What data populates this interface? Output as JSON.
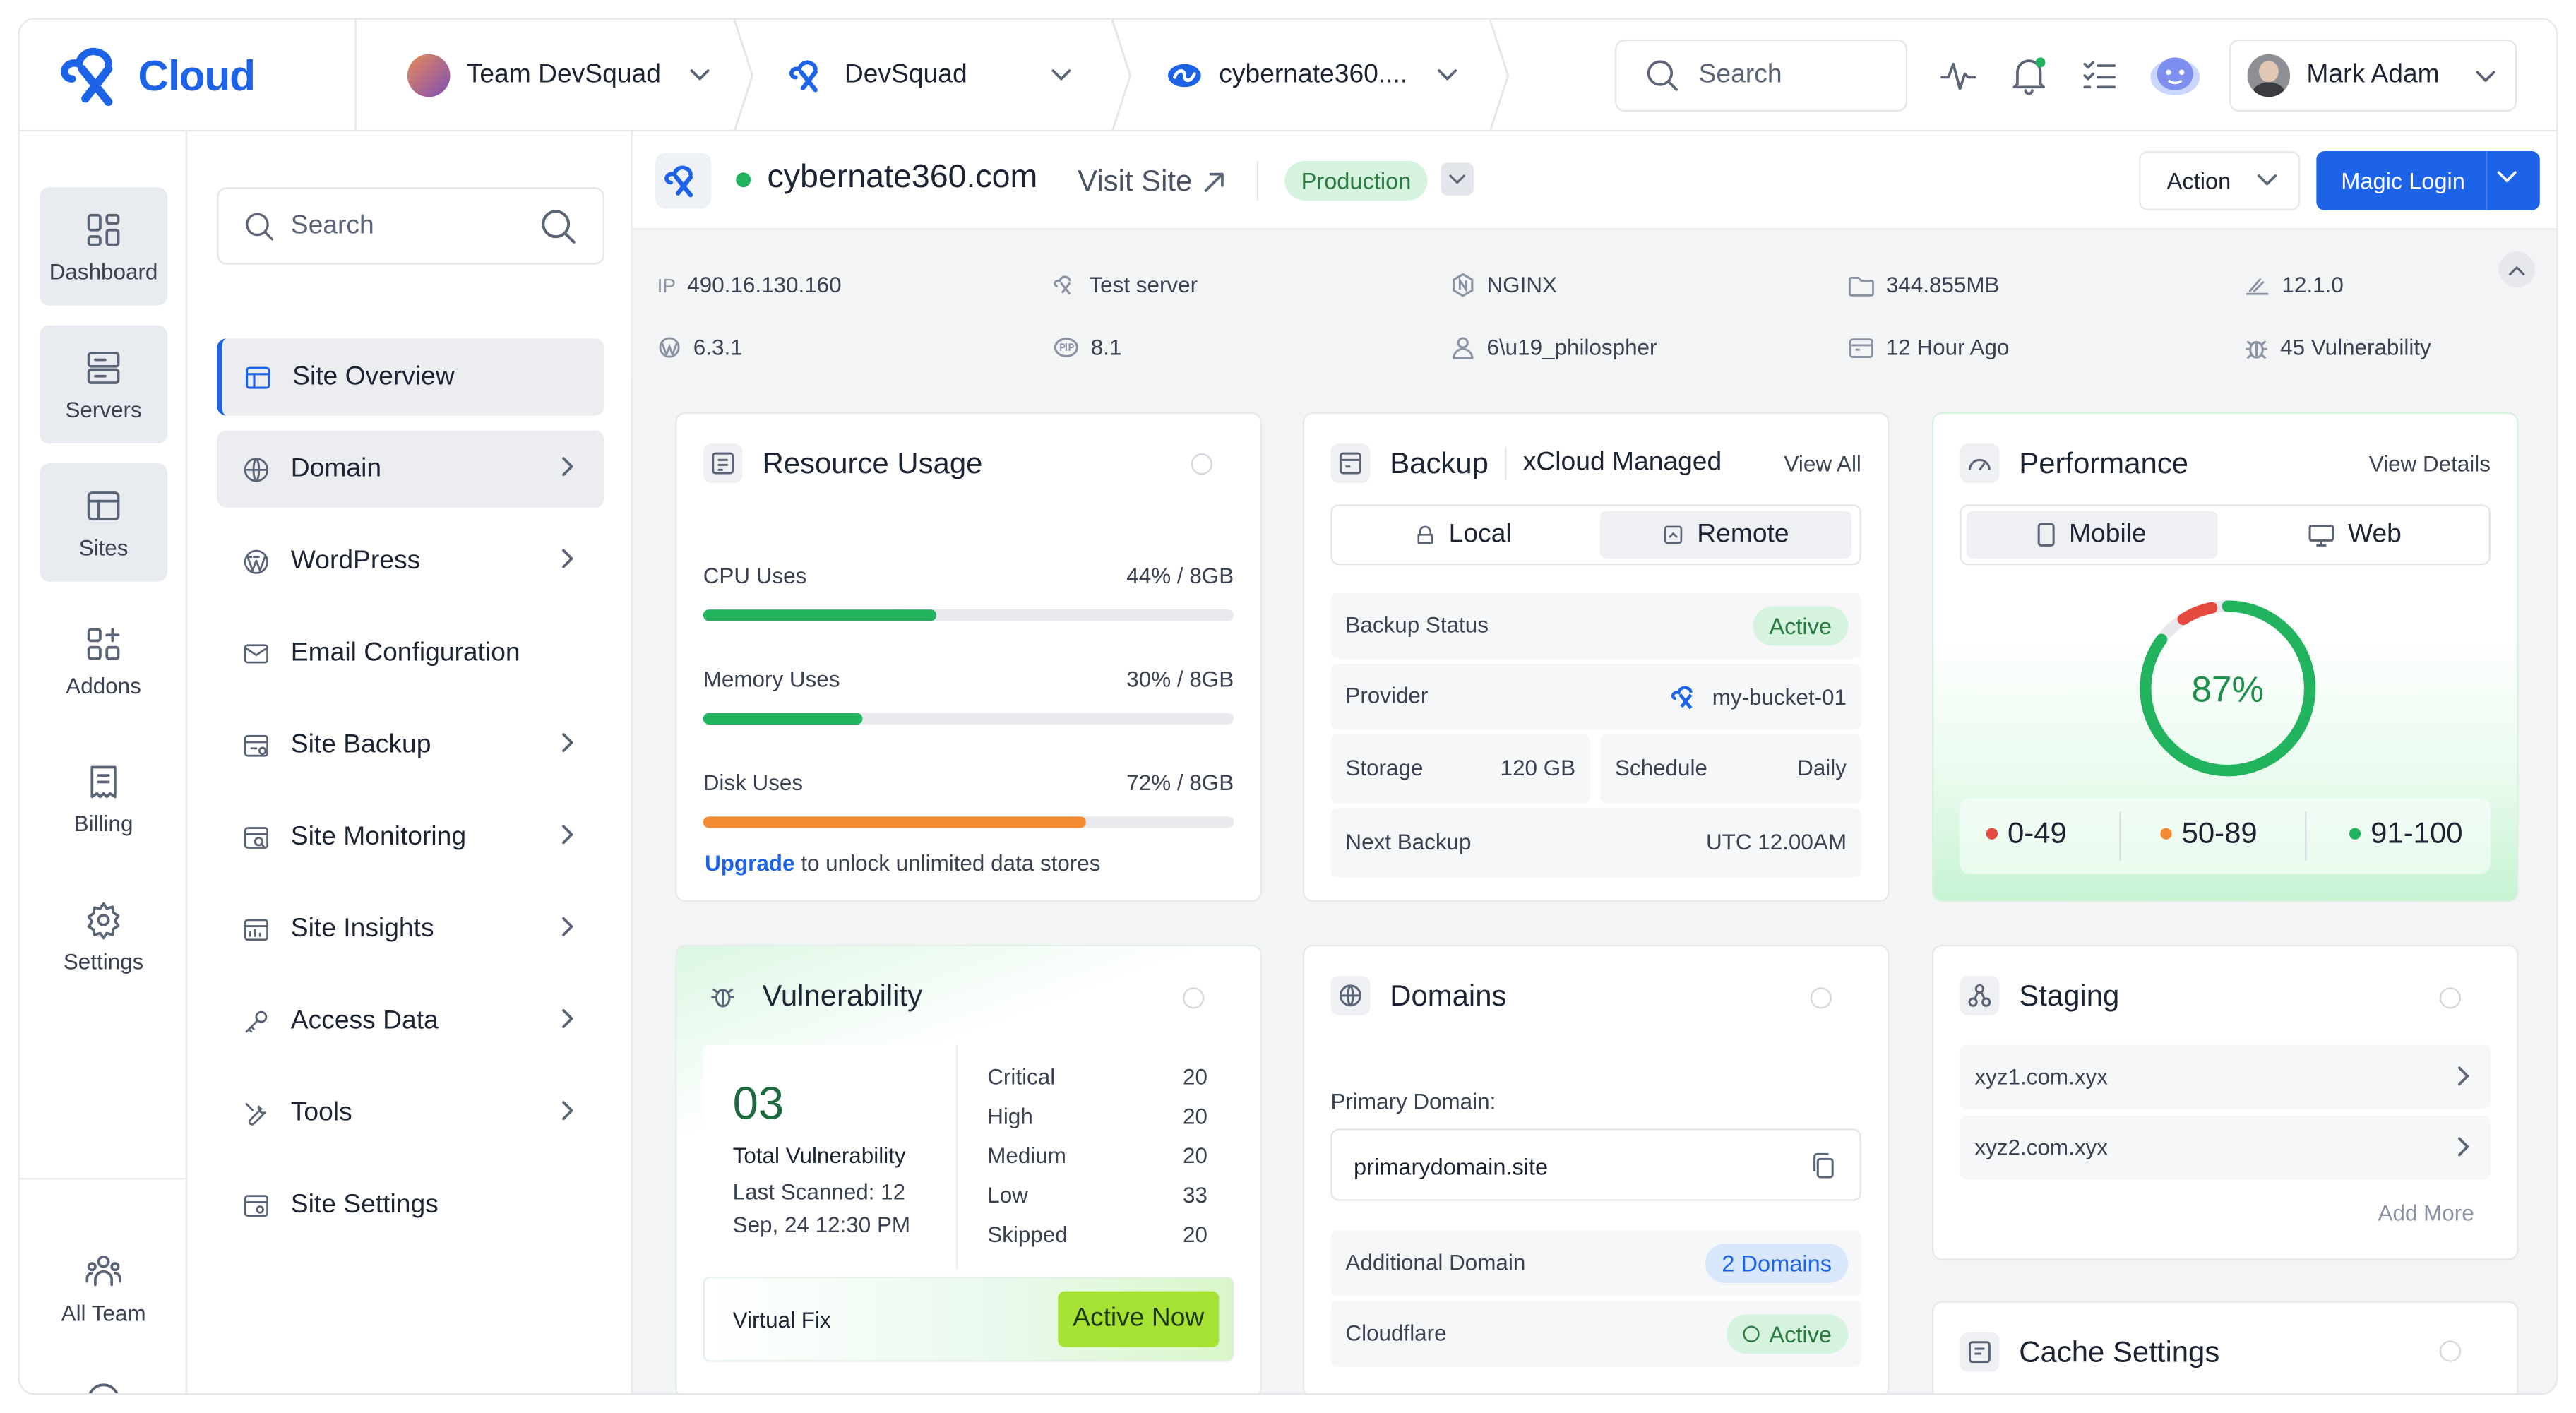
{
  "brand": {
    "name": "Cloud"
  },
  "topbar": {
    "team": "Team DevSquad",
    "project": "DevSquad",
    "site": "cybernate360....",
    "search_placeholder": "Search",
    "user_name": "Mark Adam"
  },
  "rail": {
    "items": [
      {
        "label": "Dashboard",
        "icon": "dashboard-icon"
      },
      {
        "label": "Servers",
        "icon": "servers-icon"
      },
      {
        "label": "Sites",
        "icon": "sites-icon"
      },
      {
        "label": "Addons",
        "icon": "addons-icon"
      },
      {
        "label": "Billing",
        "icon": "billing-icon"
      },
      {
        "label": "Settings",
        "icon": "settings-icon"
      },
      {
        "label": "All Team",
        "icon": "team-icon"
      }
    ]
  },
  "nav": {
    "search_placeholder": "Search",
    "items": [
      {
        "label": "Site Overview"
      },
      {
        "label": "Domain"
      },
      {
        "label": "WordPress"
      },
      {
        "label": "Email Configuration"
      },
      {
        "label": "Site Backup"
      },
      {
        "label": "Site Monitoring"
      },
      {
        "label": "Site Insights"
      },
      {
        "label": "Access Data"
      },
      {
        "label": "Tools"
      },
      {
        "label": "Site Settings"
      }
    ]
  },
  "site": {
    "name": "cybernate360.com",
    "visit_label": "Visit Site",
    "env": "Production",
    "action_label": "Action",
    "magic_label": "Magic Login"
  },
  "info": {
    "ip_prefix": "IP",
    "ip": "490.16.130.160",
    "server": "Test server",
    "webserver": "NGINX",
    "size": "344.855MB",
    "version": "12.1.0",
    "wp_version": "6.3.1",
    "php_version": "8.1",
    "user": "6\\u19_philospher",
    "updated": "12 Hour Ago",
    "vulnerability": "45 Vulnerability"
  },
  "resource": {
    "title": "Resource Usage",
    "cpu": {
      "label": "CPU Uses",
      "value": "44% / 8GB",
      "percent": 44,
      "color": "#22b35e"
    },
    "memory": {
      "label": "Memory Uses",
      "value": "30% / 8GB",
      "percent": 30,
      "color": "#22b35e"
    },
    "disk": {
      "label": "Disk Uses",
      "value": "72% / 8GB",
      "percent": 72,
      "color": "#f38b35"
    },
    "upgrade_link": "Upgrade",
    "upgrade_text": "to unlock unlimited data stores"
  },
  "backup": {
    "title": "Backup",
    "subtitle": "xCloud Managed",
    "view_all": "View All",
    "tab_local": "Local",
    "tab_remote": "Remote",
    "status_label": "Backup Status",
    "status_value": "Active",
    "provider_label": "Provider",
    "provider_value": "my-bucket-01",
    "storage_label": "Storage",
    "storage_value": "120 GB",
    "schedule_label": "Schedule",
    "schedule_value": "Daily",
    "next_label": "Next Backup",
    "next_value": "UTC 12.00AM"
  },
  "performance": {
    "title": "Performance",
    "view_details": "View Details",
    "tab_mobile": "Mobile",
    "tab_web": "Web",
    "score": "87%",
    "score_value": 87,
    "legend": [
      {
        "label": "0-49",
        "color": "#e5483d"
      },
      {
        "label": "50-89",
        "color": "#f38b35"
      },
      {
        "label": "91-100",
        "color": "#22b35e"
      }
    ]
  },
  "vulnerability": {
    "title": "Vulnerability",
    "count": "03",
    "total_label": "Total Vulnerability",
    "scanned": "Last Scanned: 12 Sep, 24 12:30 PM",
    "rows": [
      {
        "label": "Critical",
        "value": "20"
      },
      {
        "label": "High",
        "value": "20"
      },
      {
        "label": "Medium",
        "value": "20"
      },
      {
        "label": "Low",
        "value": "33"
      },
      {
        "label": "Skipped",
        "value": "20"
      }
    ],
    "virtual_fix": "Virtual Fix",
    "active_now": "Active Now"
  },
  "domains": {
    "title": "Domains",
    "primary_label": "Primary Domain:",
    "primary_value": "primarydomain.site",
    "additional_label": "Additional Domain",
    "additional_value": "2 Domains",
    "cloudflare_label": "Cloudflare",
    "cloudflare_value": "Active"
  },
  "staging": {
    "title": "Staging",
    "items": [
      "xyz1.com.xyx",
      "xyz2.com.xyx"
    ],
    "add_more": "Add More"
  },
  "cache": {
    "title": "Cache Settings"
  }
}
